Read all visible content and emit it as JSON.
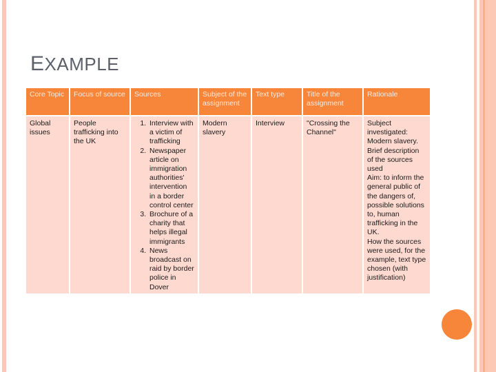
{
  "slide": {
    "title_first": "E",
    "title_rest": "XAMPLE"
  },
  "colors": {
    "accent": "#F7863A",
    "cell_bg": "#FDD9D0",
    "stripe": "#F9C8B8",
    "title": "#5b6069"
  },
  "table": {
    "headers": [
      "Core Topic",
      "Focus of source",
      "Sources",
      "Subject of the assignment",
      "Text type",
      "Title of the assignment",
      "Rationale"
    ],
    "row": {
      "core_topic": "Global issues",
      "focus": "People trafficking into the UK",
      "sources": [
        "Interview with a victim of trafficking",
        "Newspaper article on immigration authorities' intervention in a border control center",
        "Brochure of a charity that helps illegal immigrants",
        "News broadcast on raid by border police in Dover"
      ],
      "subject": "Modern slavery",
      "text_type": "Interview",
      "title": "\"Crossing the Channel\"",
      "rationale": [
        "Subject investigated: Modern slavery. Brief description of the sources used",
        "Aim: to inform the general public of the dangers of, possible solutions to, human trafficking in the UK.",
        "How the sources were used, for the example, text type chosen (with justification)"
      ]
    }
  }
}
